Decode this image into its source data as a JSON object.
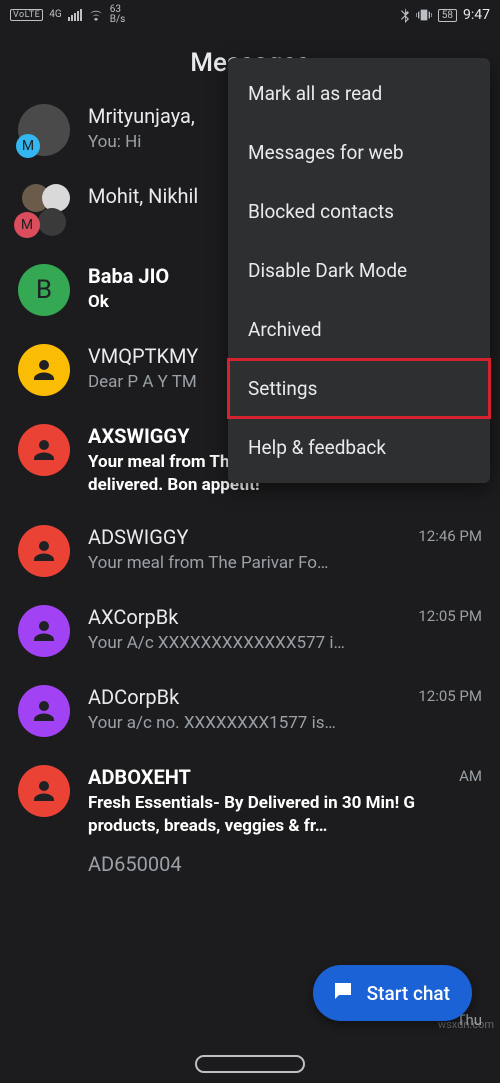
{
  "statusbar": {
    "volte": "VoLTE",
    "net_gen": "4G",
    "speed_value": "63",
    "speed_unit": "B/s",
    "battery": "58",
    "clock": "9:47"
  },
  "header": {
    "title": "Messages"
  },
  "menu": {
    "items": [
      "Mark all as read",
      "Messages for web",
      "Blocked contacts",
      "Disable Dark Mode",
      "Archived",
      "Settings",
      "Help & feedback"
    ],
    "highlighted_index": 5
  },
  "conversations": [
    {
      "title": "Mrityunjaya,",
      "snippet": "You: Hi",
      "time": "",
      "unread": false,
      "avatar": {
        "type": "photo_m"
      }
    },
    {
      "title": "Mohit, Nikhil",
      "snippet": "",
      "time": "",
      "unread": false,
      "avatar": {
        "type": "group_m"
      }
    },
    {
      "title": "Baba JIO",
      "snippet": "Ok",
      "time": "",
      "unread": true,
      "avatar": {
        "type": "letter",
        "letter": "B",
        "color": "#34a853"
      }
    },
    {
      "title": "VMQPTKMY",
      "snippet": "Dear P A Y TM",
      "time": "",
      "unread": false,
      "avatar": {
        "type": "person",
        "color": "#fbbc04"
      }
    },
    {
      "title": "AXSWIGGY",
      "snippet": "Your meal from The Parivar Food has been delivered. Bon appetit!",
      "time": "",
      "unread": true,
      "avatar": {
        "type": "person",
        "color": "#ea4335"
      }
    },
    {
      "title": "ADSWIGGY",
      "snippet": "Your meal from The Parivar Fo…",
      "time": "12:46 PM",
      "unread": false,
      "avatar": {
        "type": "person",
        "color": "#ea4335"
      }
    },
    {
      "title": "AXCorpBk",
      "snippet": "Your A/c XXXXXXXXXXXXX577 i…",
      "time": "12:05 PM",
      "unread": false,
      "avatar": {
        "type": "person",
        "color": "#a142f4"
      }
    },
    {
      "title": "ADCorpBk",
      "snippet": "Your a/c no. XXXXXXXX1577 is…",
      "time": "12:05 PM",
      "unread": false,
      "avatar": {
        "type": "person",
        "color": "#a142f4"
      }
    },
    {
      "title": "ADBOXEHT",
      "snippet": "Fresh Essentials- By Delivered in 30 Min! G products, breads, veggies & fr…",
      "time": "AM",
      "unread": true,
      "avatar": {
        "type": "person",
        "color": "#ea4335"
      }
    }
  ],
  "peek": {
    "title": "AD650004",
    "time": "Thu"
  },
  "fab": {
    "label": "Start chat"
  },
  "watermark": "wsxdn.com"
}
